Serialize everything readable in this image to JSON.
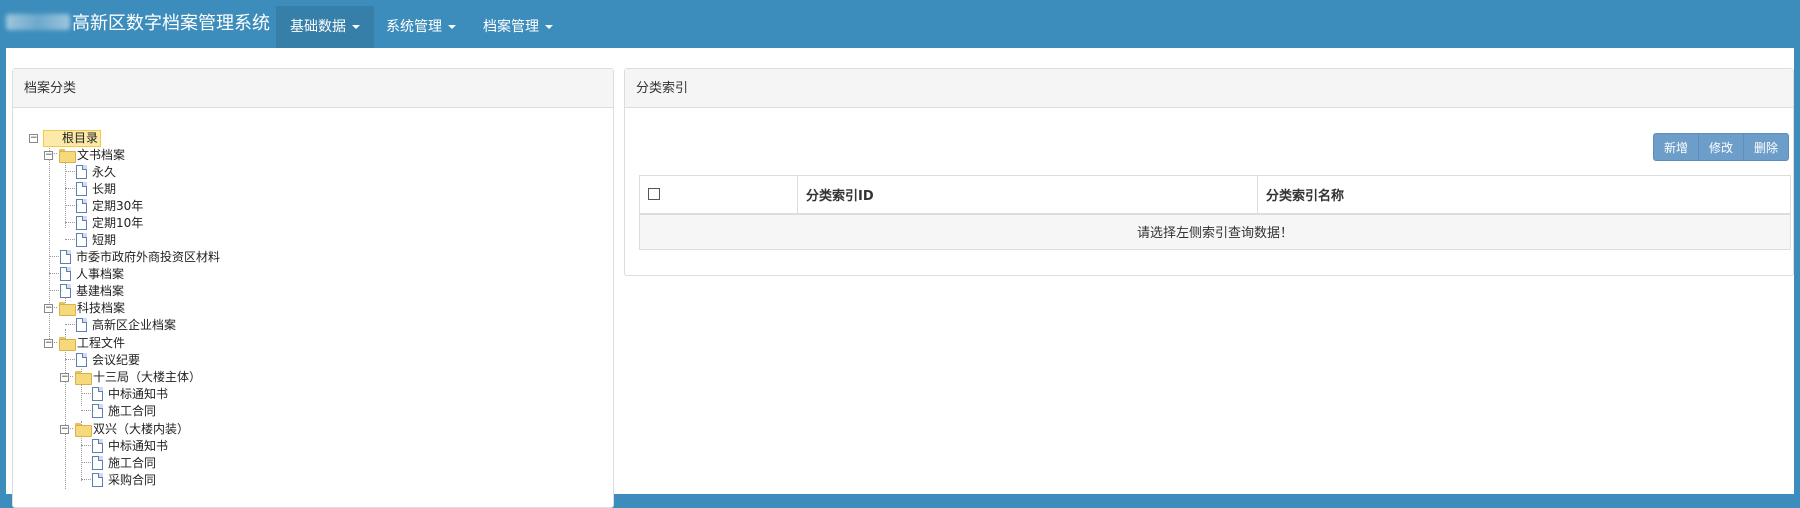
{
  "app": {
    "title": "高新区数字档案管理系统"
  },
  "nav": {
    "items": [
      {
        "label": "基础数据",
        "active": true
      },
      {
        "label": "系统管理",
        "active": false
      },
      {
        "label": "档案管理",
        "active": false
      }
    ]
  },
  "left_panel": {
    "title": "档案分类",
    "tree": [
      {
        "label": "根目录",
        "type": "folder",
        "level": 0,
        "expanded": true,
        "selected": true
      },
      {
        "label": "文书档案",
        "type": "folder",
        "level": 1,
        "expanded": true
      },
      {
        "label": "永久",
        "type": "file",
        "level": 2
      },
      {
        "label": "长期",
        "type": "file",
        "level": 2
      },
      {
        "label": "定期30年",
        "type": "file",
        "level": 2
      },
      {
        "label": "定期10年",
        "type": "file",
        "level": 2
      },
      {
        "label": "短期",
        "type": "file",
        "level": 2
      },
      {
        "label": "市委市政府外商投资区材料",
        "type": "file",
        "level": 1
      },
      {
        "label": "人事档案",
        "type": "file",
        "level": 1
      },
      {
        "label": "基建档案",
        "type": "file",
        "level": 1
      },
      {
        "label": "科技档案",
        "type": "folder",
        "level": 1,
        "expanded": true
      },
      {
        "label": "高新区企业档案",
        "type": "file",
        "level": 2
      },
      {
        "label": "工程文件",
        "type": "folder",
        "level": 1,
        "expanded": true
      },
      {
        "label": "会议纪要",
        "type": "file",
        "level": 2
      },
      {
        "label": "十三局（大楼主体）",
        "type": "folder",
        "level": 2,
        "expanded": true
      },
      {
        "label": "中标通知书",
        "type": "file",
        "level": 3
      },
      {
        "label": "施工合同",
        "type": "file",
        "level": 3
      },
      {
        "label": "双兴（大楼内装）",
        "type": "folder",
        "level": 2,
        "expanded": true
      },
      {
        "label": "中标通知书",
        "type": "file",
        "level": 3
      },
      {
        "label": "施工合同",
        "type": "file",
        "level": 3
      },
      {
        "label": "采购合同",
        "type": "file",
        "level": 3
      }
    ]
  },
  "right_panel": {
    "title": "分类索引",
    "buttons": {
      "add": "新增",
      "edit": "修改",
      "delete": "删除"
    },
    "table": {
      "columns": [
        "分类索引ID",
        "分类索引名称"
      ],
      "empty_message": "请选择左侧索引查询数据！"
    }
  }
}
